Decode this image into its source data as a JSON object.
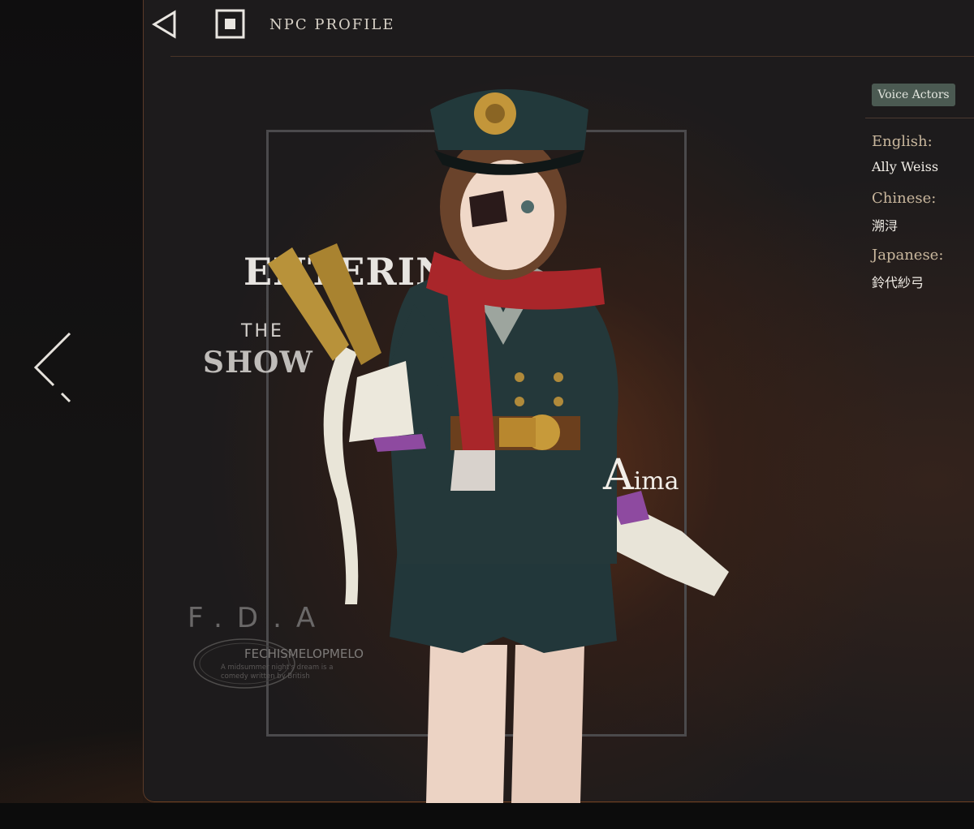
{
  "header": {
    "title": "NPC PROFILE",
    "back_icon": "triangle-left-icon",
    "stop_icon": "square-stop-icon"
  },
  "navigation": {
    "prev_icon": "chevron-left-icon"
  },
  "background_art": {
    "title_line1": "ENTERIN",
    "title_line2": "THE",
    "title_line3": "SHOW",
    "watermark": "F.D.A",
    "seal_brand": "FECHISMELOPMELO",
    "seal_subtext": "A midsummer night's dream is a comedy written by British"
  },
  "character": {
    "name_initial": "A",
    "name_rest": "ima"
  },
  "voice_actors": {
    "badge": "Voice Actors",
    "entries": [
      {
        "label": "English:",
        "value": "Ally Weiss"
      },
      {
        "label": "Chinese:",
        "value": "溯浔"
      },
      {
        "label": "Japanese:",
        "value": "鈴代紗弓"
      }
    ]
  },
  "colors": {
    "background": "#121112",
    "panel": "#1d1b1c",
    "panel_border": "#6b3f22",
    "badge_bg": "#4b5a52",
    "label": "#c9b79d",
    "text": "#f1ede6",
    "uniform": "#24383a",
    "scarf": "#a9262a"
  }
}
